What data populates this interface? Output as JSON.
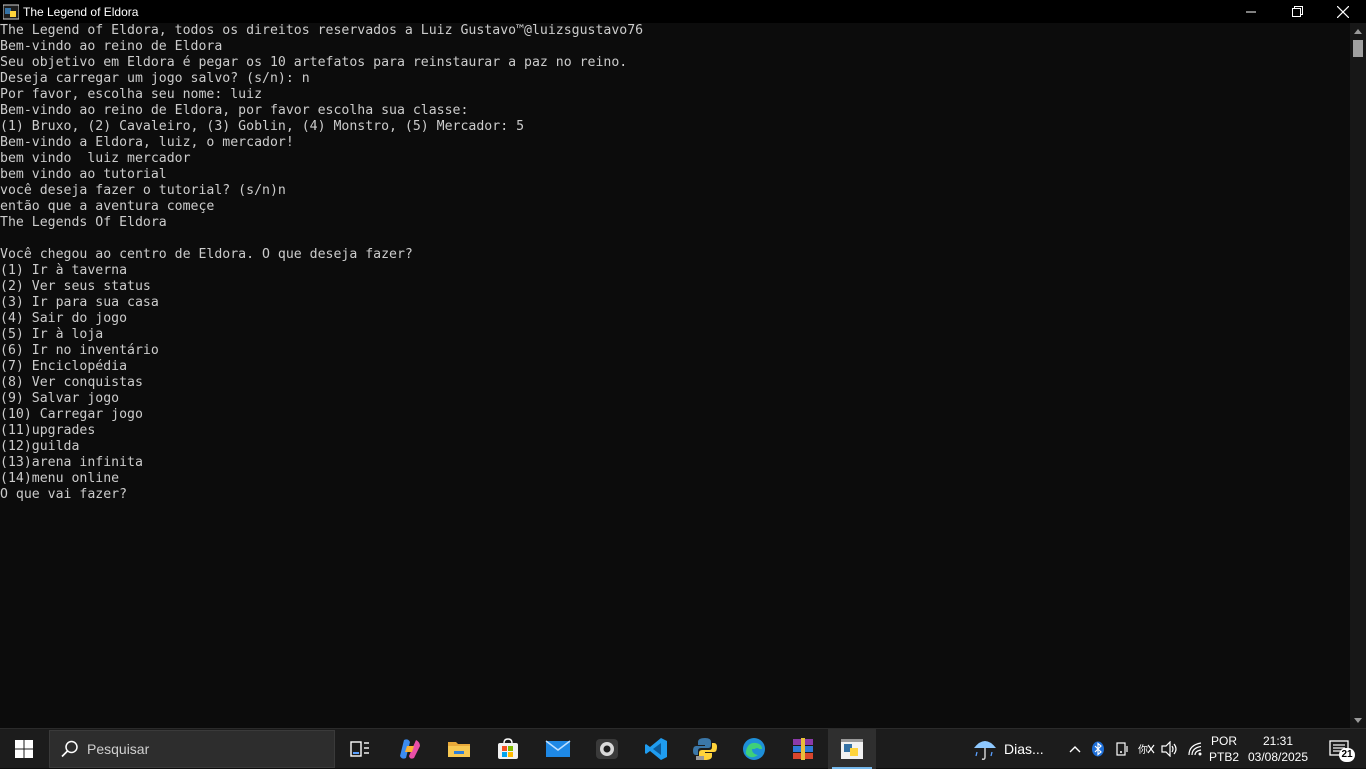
{
  "window": {
    "title": "The Legend of Eldora",
    "icon": "console-python-icon"
  },
  "console": {
    "lines": [
      "The Legend of Eldora, todos os direitos reservados a Luiz Gustavo™@luizsgustavo76",
      "Bem-vindo ao reino de Eldora",
      "Seu objetivo em Eldora é pegar os 10 artefatos para reinstaurar a paz no reino.",
      "Deseja carregar um jogo salvo? (s/n): n",
      "Por favor, escolha seu nome: luiz",
      "Bem-vindo ao reino de Eldora, por favor escolha sua classe:",
      "(1) Bruxo, (2) Cavaleiro, (3) Goblin, (4) Monstro, (5) Mercador: 5",
      "Bem-vindo a Eldora, luiz, o mercador!",
      "bem vindo  luiz mercador",
      "bem vindo ao tutorial",
      "você deseja fazer o tutorial? (s/n)n",
      "então que a aventura começe",
      "The Legends Of Eldora",
      "",
      "Você chegou ao centro de Eldora. O que deseja fazer?",
      "(1) Ir à taverna",
      "(2) Ver seus status",
      "(3) Ir para sua casa",
      "(4) Sair do jogo",
      "(5) Ir à loja",
      "(6) Ir no inventário",
      "(7) Enciclopédia",
      "(8) Ver conquistas",
      "(9) Salvar jogo",
      "(10) Carregar jogo",
      "(11)upgrades",
      "(12)guilda",
      "(13)arena infinita",
      "(14)menu online",
      "O que vai fazer?"
    ]
  },
  "taskbar": {
    "search_placeholder": "Pesquisar",
    "apps": [
      "task-view-icon",
      "copilot-icon",
      "file-explorer-icon",
      "microsoft-store-icon",
      "mail-icon",
      "webcam-icon",
      "vscode-icon",
      "python-icon",
      "edge-icon",
      "winrar-icon",
      "console-python-icon"
    ],
    "weather_text": "Dias...",
    "language_line1": "POR",
    "language_line2": "PTB2",
    "time": "21:31",
    "date": "03/08/2025",
    "notification_count": "21",
    "colors": {
      "taskbar_bg": "#1c1c1c",
      "console_bg": "#0c0c0c",
      "console_text": "#cccccc",
      "accent": "#76b9ed"
    }
  }
}
